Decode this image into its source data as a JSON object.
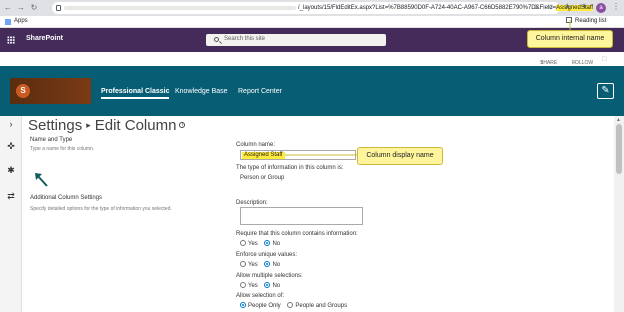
{
  "browser": {
    "url_visible": "/_layouts/15/FldEditEx.aspx?List=%7B88590D0F-A724-40AC-A967-C66D5882E790%7D&Field=",
    "url_field": "AssignedStaff",
    "bookmarks_apps": "Apps",
    "reading_list": "Reading list"
  },
  "suitebar": {
    "title": "SharePoint",
    "search_placeholder": "Search this site"
  },
  "callouts": {
    "internal": "Column internal name",
    "display": "Column display name"
  },
  "share_row": {
    "share": "SHARE",
    "follow": "FOLLOW"
  },
  "site": {
    "logo_letter": "S",
    "nav": [
      "Professional Classic",
      "Knowledge Base",
      "Report Center"
    ]
  },
  "page": {
    "breadcrumb_root": "Settings",
    "breadcrumb_separator": "▸",
    "breadcrumb_current": "Edit Column"
  },
  "sections": {
    "name_type_title": "Name and Type",
    "name_type_desc": "Type a name for this column.",
    "additional_title": "Additional Column Settings",
    "additional_desc": "Specify detailed options for the type of information you selected."
  },
  "form": {
    "column_name_label": "Column name:",
    "column_name_value": "Assigned Staff",
    "type_label": "The type of information in this column is:",
    "type_value": "Person or Group",
    "description_label": "Description:",
    "require_label": "Require that this column contains information:",
    "enforce_label": "Enforce unique values:",
    "multiple_label": "Allow multiple selections:",
    "selection_label": "Allow selection of:",
    "yes": "Yes",
    "no": "No",
    "people_only": "People Only",
    "people_groups": "People and Groups"
  }
}
